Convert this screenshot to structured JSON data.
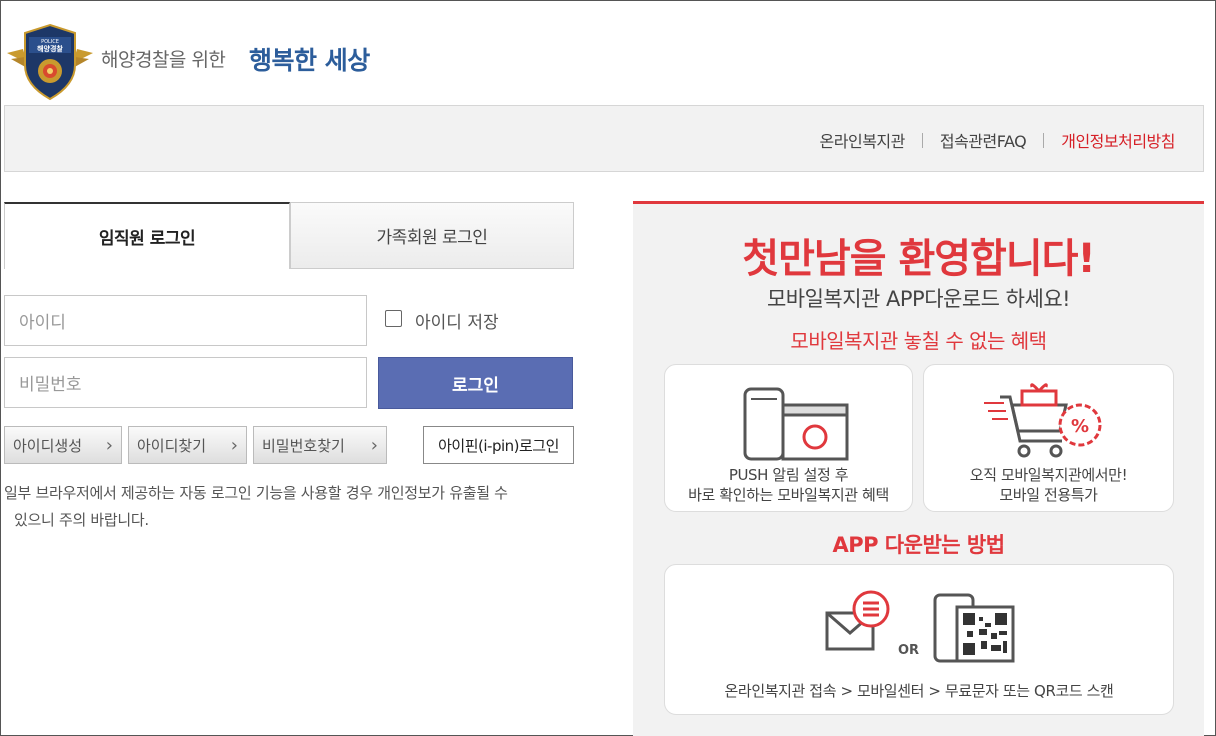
{
  "header": {
    "brand_sub": "해양경찰을 위한",
    "brand_main": "행복한 세상",
    "logo_text_top": "POLICE",
    "logo_text_main": "해양경찰"
  },
  "nav": {
    "items": [
      "온라인복지관",
      "접속관련FAQ",
      "개인정보처리방침"
    ]
  },
  "login": {
    "tabs": [
      {
        "label": "임직원 로그인",
        "active": true
      },
      {
        "label": "가족회원 로그인",
        "active": false
      }
    ],
    "id_placeholder": "아이디",
    "pw_placeholder": "비밀번호",
    "save_id_label": "아이디 저장",
    "login_button": "로그인",
    "links": [
      "아이디생성",
      "아이디찾기",
      "비밀번호찾기"
    ],
    "ipin_button": "아이핀(i-pin)로그인",
    "notice_line1": "일부 브라우저에서 제공하는 자동 로그인 기능을 사용할 경우 개인정보가 유출될 수",
    "notice_line2": "있으니 주의 바랍니다."
  },
  "promo": {
    "title": "첫만남을 환영합니다!",
    "subtitle": "모바일복지관 APP다운로드 하세요!",
    "benefit_heading": "모바일복지관 놓칠 수 없는 혜택",
    "card1_line1": "PUSH 알림 설정 후",
    "card1_line2": "바로 확인하는 모바일복지관 혜택",
    "card2_line1": "오직 모바일복지관에서만!",
    "card2_line2": "모바일 전용특가",
    "how_heading": "APP 다운받는 방법",
    "or_label": "OR",
    "how_text": "온라인복지관 접속 > 모바일센터 > 무료문자 또는 QR코드 스캔"
  },
  "colors": {
    "accent_red": "#e0383d",
    "brand_blue": "#2c5d9b",
    "login_button": "#5a6db3"
  }
}
